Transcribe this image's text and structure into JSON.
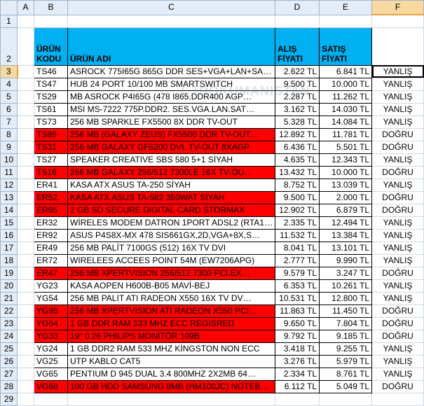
{
  "columns": [
    "A",
    "B",
    "C",
    "D",
    "E",
    "F"
  ],
  "selected_column": "F",
  "selected_row": "3",
  "header_row": {
    "row": "2",
    "code": "ÜRÜN KODU",
    "name": "ÜRÜN ADI",
    "buy": "ALIŞ FİYATI",
    "sell": "SATIŞ FİYATI"
  },
  "empty_row": "1",
  "rows": [
    {
      "row": "3",
      "code": "TS46",
      "name": "ASROCK 775I65G 865G DDR SES+VGA+LAN+SA…",
      "buy": "2.622 TL",
      "sell": "6.841 TL",
      "result": "YANLIŞ",
      "red": false
    },
    {
      "row": "4",
      "code": "TS47",
      "name": "HUB 24 PORT 10/100 MB SMARTSWITCH",
      "buy": "9.500 TL",
      "sell": "10.000 TL",
      "result": "YANLIŞ",
      "red": false
    },
    {
      "row": "5",
      "code": "TS29",
      "name": "MB ASROCK P4I65G (478 I865.DDR400 AGP…",
      "buy": "2.287 TL",
      "sell": "11.262 TL",
      "result": "YANLIŞ",
      "red": false
    },
    {
      "row": "6",
      "code": "TS61",
      "name": "MSI MS-7222 775P.DDR2. SES.VGA.LAN.SAT…",
      "buy": "3.162 TL",
      "sell": "14.030 TL",
      "result": "YANLIŞ",
      "red": false
    },
    {
      "row": "7",
      "code": "TS73",
      "name": "256 MB SPARKLE FX5500 8X DDR TV-OUT",
      "buy": "5.328 TL",
      "sell": "14.084 TL",
      "result": "YANLIŞ",
      "red": false
    },
    {
      "row": "8",
      "code": "TS89",
      "name": "256 MB (GALAXY ZEUS) FX5500 DDR TV-OUT…",
      "buy": "12.892 TL",
      "sell": "11.781 TL",
      "result": "DOĞRU",
      "red": true
    },
    {
      "row": "9",
      "code": "TS31",
      "name": "256 MB GALAXY GF6200 DVI. TV-OUT 8XAGP",
      "buy": "6.436 TL",
      "sell": "5.501 TL",
      "result": "DOĞRU",
      "red": true
    },
    {
      "row": "10",
      "code": "TS27",
      "name": "SPEAKER CREATIVE SBS 580 5+1 SİYAH",
      "buy": "4.635 TL",
      "sell": "12.343 TL",
      "result": "YANLIŞ",
      "red": false
    },
    {
      "row": "11",
      "code": "TS18",
      "name": "256 MB GALAXY 256/512 7300LE 16X TV-OU…",
      "buy": "13.432 TL",
      "sell": "10.000 TL",
      "result": "DOĞRU",
      "red": true
    },
    {
      "row": "12",
      "code": "ER41",
      "name": "KASA ATX ASUS TA-250 SİYAH",
      "buy": "8.752 TL",
      "sell": "13.039 TL",
      "result": "YANLIŞ",
      "red": false
    },
    {
      "row": "13",
      "code": "ER52",
      "name": "KASA ATX ASUS TA-582 350WAT SİYAH",
      "buy": "9.500 TL",
      "sell": "2.000 TL",
      "result": "DOĞRU",
      "red": true
    },
    {
      "row": "14",
      "code": "ER95",
      "name": "2 GB SD SECURE DIGITAL CARD STORMAX",
      "buy": "12.902 TL",
      "sell": "6.879 TL",
      "result": "DOĞRU",
      "red": true
    },
    {
      "row": "15",
      "code": "ER32",
      "name": "WİRELES MODEM DATRON 1PORT ADSL2 (RTA1…",
      "buy": "2.335 TL",
      "sell": "12.494 TL",
      "result": "YANLIŞ",
      "red": false
    },
    {
      "row": "16",
      "code": "ER92",
      "name": "ASUS P4S8X-MX 478 SIS661GX,2D,VGA+8X,S…",
      "buy": "11.532 TL",
      "sell": "13.384 TL",
      "result": "YANLIŞ",
      "red": false
    },
    {
      "row": "17",
      "code": "ER49",
      "name": "256 MB PALİT 7100GS (512) 16X TV DVI",
      "buy": "8.041 TL",
      "sell": "13.101 TL",
      "result": "YANLIŞ",
      "red": false
    },
    {
      "row": "18",
      "code": "ER72",
      "name": "WIRELEES ACCEES POINT 54M (EW7206APG)",
      "buy": "2.777 TL",
      "sell": "9.990 TL",
      "result": "YANLIŞ",
      "red": false
    },
    {
      "row": "19",
      "code": "ER47",
      "name": "256 MB XPERTVISION 256/512 7300 PCI.EX…",
      "buy": "9.579 TL",
      "sell": "3.247 TL",
      "result": "DOĞRU",
      "red": true
    },
    {
      "row": "20",
      "code": "YG23",
      "name": "KASA AOPEN H600B-B05 MAVİ-BEJ",
      "buy": "6.353 TL",
      "sell": "10.261 TL",
      "result": "YANLIŞ",
      "red": false
    },
    {
      "row": "21",
      "code": "YG54",
      "name": "256 MB PALIT ATI RADEON X550 16X TV DV…",
      "buy": "10.531 TL",
      "sell": "12.800 TL",
      "result": "YANLIŞ",
      "red": false
    },
    {
      "row": "22",
      "code": "YG95",
      "name": "256 MB XPERTVISION ATI RADEON X550 PCI…",
      "buy": "11.863 TL",
      "sell": "11.450 TL",
      "result": "DOĞRU",
      "red": true
    },
    {
      "row": "23",
      "code": "YG54",
      "name": "1 GB DDR RAM 333 MHZ ECC REGISRED",
      "buy": "9.650 TL",
      "sell": "7.804 TL",
      "result": "DOĞRU",
      "red": true
    },
    {
      "row": "24",
      "code": "YG33",
      "name": "19\" 0.26 PHILIPS MONİTÖR 109B",
      "buy": "9.792 TL",
      "sell": "9.185 TL",
      "result": "DOĞRU",
      "red": true
    },
    {
      "row": "25",
      "code": "YG24",
      "name": "1 GB DDR2 RAM 533 MHZ KİNGSTON NON ECC",
      "buy": "3.418 TL",
      "sell": "9.255 TL",
      "result": "YANLIŞ",
      "red": false
    },
    {
      "row": "26",
      "code": "VG25",
      "name": "UTP KABLO CAT5",
      "buy": "3.276 TL",
      "sell": "5.979 TL",
      "result": "YANLIŞ",
      "red": false
    },
    {
      "row": "27",
      "code": "VG65",
      "name": "PENTIUM D 945 DUAL 3.4 800MHZ 2X2MB 64…",
      "buy": "2.334 TL",
      "sell": "8.761 TL",
      "result": "YANLIŞ",
      "red": false
    },
    {
      "row": "28",
      "code": "VG68",
      "name": "100 GB HDD SAMSUNG 8MB (HM100JC) NOTEB…",
      "buy": "6.112 TL",
      "sell": "5.049 TL",
      "result": "DOĞRU",
      "red": true
    }
  ],
  "tail_row": "29",
  "watermark": "DOKUMANISTAN"
}
